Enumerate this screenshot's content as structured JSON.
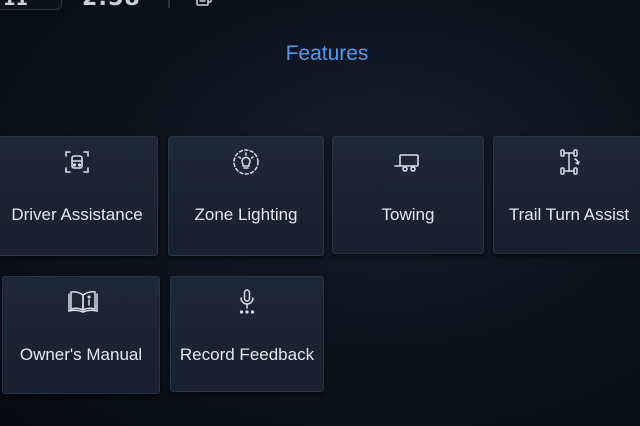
{
  "status_bar": {
    "left_text": "11",
    "clock": "2:58",
    "right_icon": "stack-pages-icon"
  },
  "page": {
    "title": "Features"
  },
  "tiles": [
    {
      "label": "Driver Assistance",
      "icon": "driver-assist-icon"
    },
    {
      "label": "Zone Lighting",
      "icon": "zone-lighting-icon"
    },
    {
      "label": "Towing",
      "icon": "trailer-icon"
    },
    {
      "label": "Trail Turn Assist",
      "icon": "trail-turn-icon"
    },
    {
      "label": "Owner's Manual",
      "icon": "book-info-icon"
    },
    {
      "label": "Record Feedback",
      "icon": "microphone-icon"
    }
  ],
  "colors": {
    "title_accent": "#4a9cf2",
    "tile_bg": "#1b2535",
    "icon_stroke": "#d8dee8"
  }
}
